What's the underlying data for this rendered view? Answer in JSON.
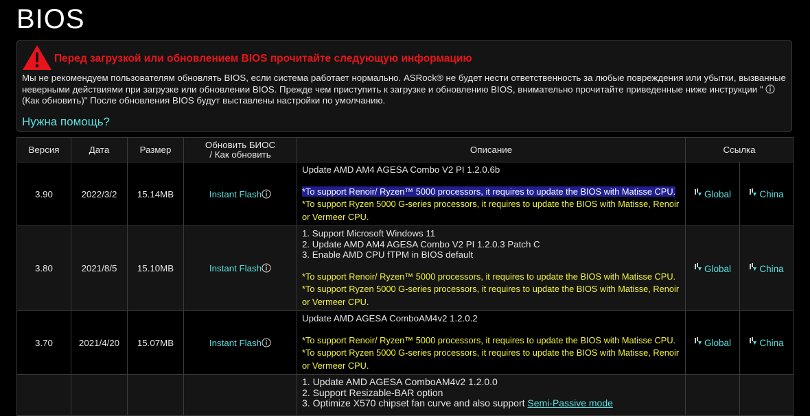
{
  "page": {
    "title": "BIOS"
  },
  "notice": {
    "title": "Перед загрузкой или обновлением BIOS прочитайте следующую информацию",
    "text_before": "Мы не рекомендуем пользователям обновлять BIOS, если система работает нормально. ASRock® не будет нести ответственность за любые повреждения или убытки, вызванные неверными действиями при загрузке или обновлении BIOS. Прежде чем приступить к загрузке и обновлению BIOS, внимательно прочитайте приведенные ниже инструкции \" ",
    "text_after": " (Как обновить)\" После обновления BIOS будут выставлены настройки по умолчанию.",
    "help_link": "Нужна помощь?",
    "icon": "warning-triangle-icon"
  },
  "table": {
    "headers": {
      "version": "Версия",
      "date": "Дата",
      "size": "Размер",
      "update_line1": "Обновить БИОС",
      "update_line2": "/ Как обновить",
      "description": "Описание",
      "link": "Ссылка"
    },
    "rows": [
      {
        "version": "3.90",
        "date": "2022/3/2",
        "size": "15.14MB",
        "flash": "Instant Flash",
        "lines": [
          "Update AMD AM4 AGESA Combo V2 PI 1.2.0.6b"
        ],
        "notes": [
          "*To support Renoir/ Ryzen™ 5000 processors, it requires to update the BIOS with Matisse CPU.",
          "*To support Ryzen 5000 G-series processors, it requires to update the BIOS with Matisse, Renoir or Vermeer CPU."
        ],
        "global": "Global",
        "china": "China"
      },
      {
        "version": "3.80",
        "date": "2021/8/5",
        "size": "15.10MB",
        "flash": "Instant Flash",
        "lines": [
          "1. Support Microsoft Windows 11",
          "2. Update AMD AM4 AGESA Combo V2 PI 1.2.0.3 Patch C",
          "3. Enable AMD CPU fTPM in BIOS default"
        ],
        "notes": [
          "*To support Renoir/ Ryzen™ 5000 processors, it requires to update the BIOS with Matisse CPU.",
          "*To support Ryzen 5000 G-series processors, it requires to update the BIOS with Matisse, Renoir or Vermeer CPU."
        ],
        "global": "Global",
        "china": "China"
      },
      {
        "version": "3.70",
        "date": "2021/4/20",
        "size": "15.07MB",
        "flash": "Instant Flash",
        "lines": [
          "Update AMD AGESA ComboAM4v2 1.2.0.2"
        ],
        "notes": [
          "*To support Renoir/ Ryzen™ 5000 processors, it requires to update the BIOS with Matisse CPU.",
          "*To support Ryzen 5000 G-series processors, it requires to update the BIOS with Matisse, Renoir or Vermeer CPU."
        ],
        "global": "Global",
        "china": "China"
      },
      {
        "lines": [
          "1. Update AMD AGESA ComboAM4v2 1.2.0.0",
          "2. Support Resizable-BAR option",
          "3. Optimize X570 chipset fan curve and also support "
        ],
        "link_text": "Semi-Passive mode"
      }
    ]
  },
  "colors": {
    "accent": "#5ce0e0",
    "warning": "#e8141b",
    "note": "#f5f53a",
    "highlight": "#1f1f8f"
  }
}
